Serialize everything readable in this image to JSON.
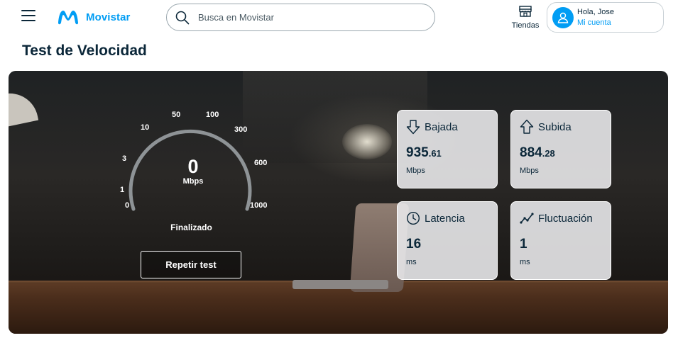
{
  "header": {
    "menu_icon": "hamburger-menu-icon",
    "brand_name": "Movistar",
    "brand_color": "#019df4",
    "search_placeholder": "Busca en Movistar",
    "stores_label": "Tiendas",
    "account_greeting": "Hola, Jose",
    "account_link": "Mi cuenta"
  },
  "page": {
    "title": "Test de Velocidad"
  },
  "gauge": {
    "ticks": [
      "0",
      "1",
      "3",
      "10",
      "50",
      "100",
      "300",
      "600",
      "1000"
    ],
    "value": "0",
    "unit": "Mbps",
    "status": "Finalizado",
    "repeat_label": "Repetir test"
  },
  "cards": {
    "download": {
      "title": "Bajada",
      "value_int": "935",
      "value_dec": ".61",
      "unit": "Mbps",
      "icon": "arrow-down-icon"
    },
    "upload": {
      "title": "Subida",
      "value_int": "884",
      "value_dec": ".28",
      "unit": "Mbps",
      "icon": "arrow-up-icon"
    },
    "latency": {
      "title": "Latencia",
      "value_int": "16",
      "value_dec": "",
      "unit": "ms",
      "icon": "clock-icon"
    },
    "jitter": {
      "title": "Fluctuación",
      "value_int": "1",
      "value_dec": "",
      "unit": "ms",
      "icon": "trend-line-icon"
    }
  }
}
